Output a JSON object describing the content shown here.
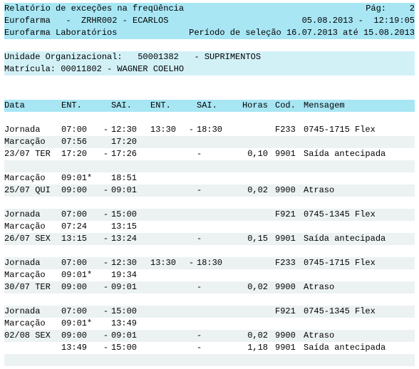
{
  "header": {
    "title": "Relatório de exceções na freqüência",
    "page_label": "Pág:",
    "page_num": "2",
    "line2_left": "Eurofarma   -  ZRHR002 - ECARLOS",
    "line2_right": "05.08.2013 -  12:19:05",
    "line3_left": "Eurofarma Laboratórios",
    "line3_right": "Período de seleção 16.07.2013 até 15.08.2013"
  },
  "org": {
    "l1": "Unidade Organizacional:   50001382   - SUPRIMENTOS",
    "l2": "Matrícula: 00011802 - WAGNER COELHO"
  },
  "cols": {
    "data": "Data",
    "ent1": "ENT.",
    "sai1": "SAI.",
    "ent2": "ENT.",
    "sai2": "SAI.",
    "horas": "Horas",
    "cod": "Cod.",
    "msg": "Mensagem"
  },
  "rows": [
    {
      "alt": false,
      "label": "Jornada",
      "ent1": "07:00",
      "sep1": "-",
      "sai1": "12:30",
      "ent2": "13:30",
      "sep2": "-",
      "sai2": "18:30",
      "horas": "",
      "cod": "F233",
      "msg": "0745-1715 Flex"
    },
    {
      "alt": true,
      "label": "Marcação",
      "ent1": "07:56",
      "sep1": "",
      "sai1": "17:20",
      "ent2": "",
      "sep2": "",
      "sai2": "",
      "horas": "",
      "cod": "",
      "msg": ""
    },
    {
      "alt": false,
      "label": "23/07 TER",
      "ent1": "17:20",
      "sep1": "-",
      "sai1": "17:26",
      "ent2": "",
      "sep2": "",
      "sai2": "-",
      "horas": "0,10",
      "cod": "9901",
      "msg": "Saída antecipada"
    },
    {
      "alt": true,
      "label": "",
      "ent1": "",
      "sep1": "",
      "sai1": "",
      "ent2": "",
      "sep2": "",
      "sai2": "",
      "horas": "",
      "cod": "",
      "msg": ""
    },
    {
      "alt": false,
      "label": "Marcação",
      "ent1": "09:01*",
      "sep1": "",
      "sai1": "18:51",
      "ent2": "",
      "sep2": "",
      "sai2": "",
      "horas": "",
      "cod": "",
      "msg": ""
    },
    {
      "alt": true,
      "label": "25/07 QUI",
      "ent1": "09:00",
      "sep1": "-",
      "sai1": "09:01",
      "ent2": "",
      "sep2": "",
      "sai2": "-",
      "horas": "0,02",
      "cod": "9900",
      "msg": "Atraso"
    },
    {
      "alt": false,
      "label": "",
      "ent1": "",
      "sep1": "",
      "sai1": "",
      "ent2": "",
      "sep2": "",
      "sai2": "",
      "horas": "",
      "cod": "",
      "msg": ""
    },
    {
      "alt": true,
      "label": "Jornada",
      "ent1": "07:00",
      "sep1": "-",
      "sai1": "15:00",
      "ent2": "",
      "sep2": "",
      "sai2": "",
      "horas": "",
      "cod": "F921",
      "msg": "0745-1345 Flex"
    },
    {
      "alt": false,
      "label": "Marcação",
      "ent1": "07:24",
      "sep1": "",
      "sai1": "13:15",
      "ent2": "",
      "sep2": "",
      "sai2": "",
      "horas": "",
      "cod": "",
      "msg": ""
    },
    {
      "alt": true,
      "label": "26/07 SEX",
      "ent1": "13:15",
      "sep1": "-",
      "sai1": "13:24",
      "ent2": "",
      "sep2": "",
      "sai2": "-",
      "horas": "0,15",
      "cod": "9901",
      "msg": "Saída antecipada"
    },
    {
      "alt": false,
      "label": "",
      "ent1": "",
      "sep1": "",
      "sai1": "",
      "ent2": "",
      "sep2": "",
      "sai2": "",
      "horas": "",
      "cod": "",
      "msg": ""
    },
    {
      "alt": true,
      "label": "Jornada",
      "ent1": "07:00",
      "sep1": "-",
      "sai1": "12:30",
      "ent2": "13:30",
      "sep2": "-",
      "sai2": "18:30",
      "horas": "",
      "cod": "F233",
      "msg": "0745-1715 Flex"
    },
    {
      "alt": false,
      "label": "Marcação",
      "ent1": "09:01*",
      "sep1": "",
      "sai1": "19:34",
      "ent2": "",
      "sep2": "",
      "sai2": "",
      "horas": "",
      "cod": "",
      "msg": ""
    },
    {
      "alt": true,
      "label": "30/07 TER",
      "ent1": "09:00",
      "sep1": "-",
      "sai1": "09:01",
      "ent2": "",
      "sep2": "",
      "sai2": "-",
      "horas": "0,02",
      "cod": "9900",
      "msg": "Atraso"
    },
    {
      "alt": false,
      "label": "",
      "ent1": "",
      "sep1": "",
      "sai1": "",
      "ent2": "",
      "sep2": "",
      "sai2": "",
      "horas": "",
      "cod": "",
      "msg": ""
    },
    {
      "alt": true,
      "label": "Jornada",
      "ent1": "07:00",
      "sep1": "-",
      "sai1": "15:00",
      "ent2": "",
      "sep2": "",
      "sai2": "",
      "horas": "",
      "cod": "F921",
      "msg": "0745-1345 Flex"
    },
    {
      "alt": false,
      "label": "Marcação",
      "ent1": "09:01*",
      "sep1": "",
      "sai1": "13:49",
      "ent2": "",
      "sep2": "",
      "sai2": "",
      "horas": "",
      "cod": "",
      "msg": ""
    },
    {
      "alt": true,
      "label": "02/08 SEX",
      "ent1": "09:00",
      "sep1": "-",
      "sai1": "09:01",
      "ent2": "",
      "sep2": "",
      "sai2": "-",
      "horas": "0,02",
      "cod": "9900",
      "msg": "Atraso"
    },
    {
      "alt": false,
      "label": "",
      "ent1": "13:49",
      "sep1": "-",
      "sai1": "15:00",
      "ent2": "",
      "sep2": "",
      "sai2": "-",
      "horas": "1,18",
      "cod": "9901",
      "msg": "Saída antecipada"
    },
    {
      "alt": true,
      "label": "",
      "ent1": "",
      "sep1": "",
      "sai1": "",
      "ent2": "",
      "sep2": "",
      "sai2": "",
      "horas": "",
      "cod": "",
      "msg": ""
    }
  ]
}
